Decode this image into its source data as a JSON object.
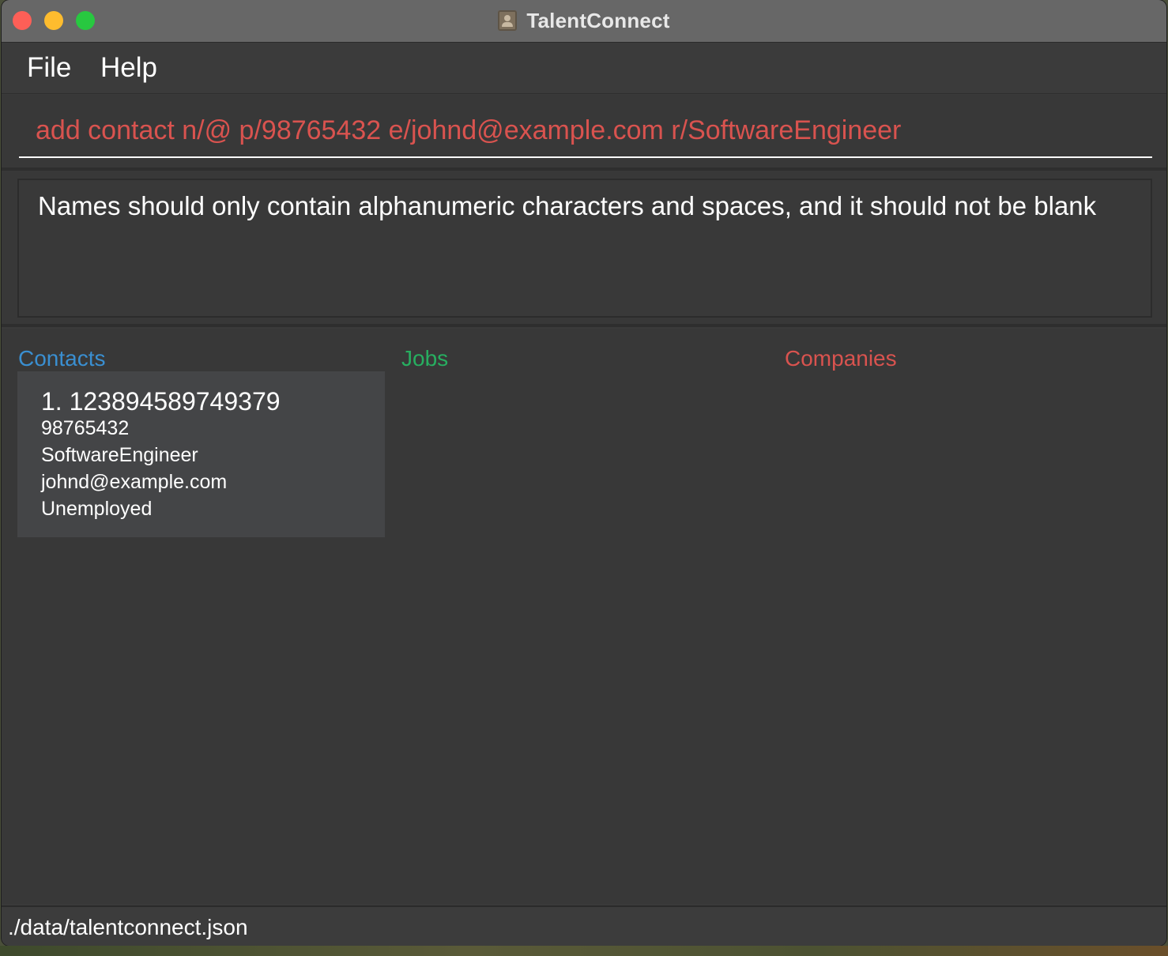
{
  "window": {
    "title": "TalentConnect"
  },
  "menu": {
    "items": [
      {
        "label": "File"
      },
      {
        "label": "Help"
      }
    ]
  },
  "command": {
    "value": "add contact n/@ p/98765432 e/johnd@example.com r/SoftwareEngineer"
  },
  "result": {
    "message": "Names should only contain alphanumeric characters and spaces, and it should not be blank"
  },
  "lists": {
    "contacts_label": "Contacts",
    "jobs_label": "Jobs",
    "companies_label": "Companies",
    "contacts": [
      {
        "title": "1. 123894589749379",
        "phone": "98765432",
        "role": "SoftwareEngineer",
        "email": "johnd@example.com",
        "status": "Unemployed"
      }
    ]
  },
  "status_bar": {
    "path": "./data/talentconnect.json"
  },
  "colors": {
    "contacts_accent": "#3a8fd1",
    "jobs_accent": "#27ae60",
    "companies_accent": "#d9534f",
    "error_text": "#d9534f"
  }
}
